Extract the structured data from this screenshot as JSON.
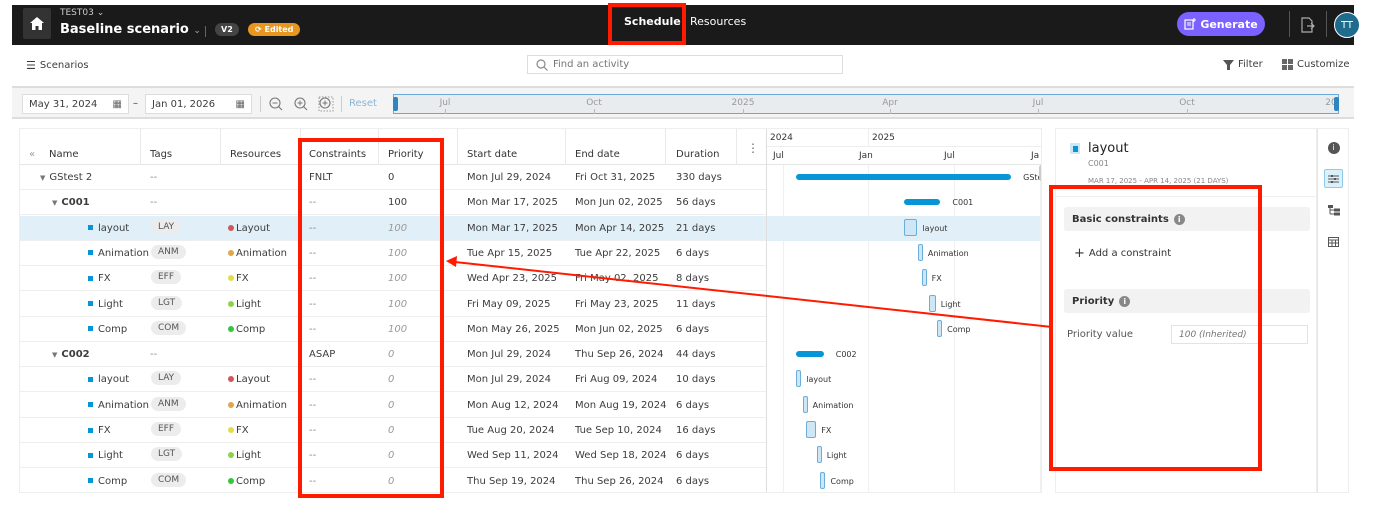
{
  "header": {
    "project": "TEST03",
    "scenario": "Baseline scenario",
    "version": "V2",
    "edited": "Edited",
    "tabs": [
      {
        "label": "Schedule",
        "active": true
      },
      {
        "label": "Resources",
        "active": false
      }
    ],
    "generate": "Generate",
    "avatar": "TT",
    "accent_color": "#7b61ff",
    "edited_color": "#e8961f"
  },
  "toolbar": {
    "scenarios": "Scenarios",
    "search_placeholder": "Find an activity",
    "filter": "Filter",
    "customize": "Customize"
  },
  "range": {
    "start": "May 31, 2024",
    "end": "Jan 01, 2026",
    "reset": "Reset",
    "ticks": [
      "Jul",
      "Oct",
      "2025",
      "Apr",
      "Jul",
      "Oct",
      "20"
    ]
  },
  "grid": {
    "columns": [
      "Name",
      "Tags",
      "Resources",
      "Constraints",
      "Priority",
      "Start date",
      "End date",
      "Duration"
    ],
    "rows": [
      {
        "name": "GStest 2",
        "level": 0,
        "group": true,
        "tag": "--",
        "resource": "",
        "res_color": "",
        "constraint": "FNLT",
        "priority": "0",
        "pri_italic": false,
        "start": "Mon Jul 29, 2024",
        "end": "Fri Oct 31, 2025",
        "duration": "330 days"
      },
      {
        "name": "C001",
        "level": 1,
        "group": true,
        "tag": "--",
        "resource": "",
        "res_color": "",
        "constraint": "--",
        "priority": "100",
        "pri_italic": false,
        "start": "Mon Mar 17, 2025",
        "end": "Mon Jun 02, 2025",
        "duration": "56 days"
      },
      {
        "name": "layout",
        "level": 2,
        "group": false,
        "selected": true,
        "tag": "LAY",
        "resource": "Layout",
        "res_color": "#d0575a",
        "constraint": "--",
        "priority": "100",
        "pri_italic": true,
        "start": "Mon Mar 17, 2025",
        "end": "Mon Apr 14, 2025",
        "duration": "21 days"
      },
      {
        "name": "Animation",
        "level": 2,
        "group": false,
        "tag": "ANM",
        "resource": "Animation",
        "res_color": "#e0a64a",
        "constraint": "--",
        "priority": "100",
        "pri_italic": true,
        "start": "Tue Apr 15, 2025",
        "end": "Tue Apr 22, 2025",
        "duration": "6 days"
      },
      {
        "name": "FX",
        "level": 2,
        "group": false,
        "tag": "EFF",
        "resource": "FX",
        "res_color": "#e2dc4a",
        "constraint": "--",
        "priority": "100",
        "pri_italic": true,
        "start": "Wed Apr 23, 2025",
        "end": "Fri May 02, 2025",
        "duration": "8 days"
      },
      {
        "name": "Light",
        "level": 2,
        "group": false,
        "tag": "LGT",
        "resource": "Light",
        "res_color": "#8ed24a",
        "constraint": "--",
        "priority": "100",
        "pri_italic": true,
        "start": "Fri May 09, 2025",
        "end": "Fri May 23, 2025",
        "duration": "11 days"
      },
      {
        "name": "Comp",
        "level": 2,
        "group": false,
        "tag": "COM",
        "resource": "Comp",
        "res_color": "#2fc83a",
        "constraint": "--",
        "priority": "100",
        "pri_italic": true,
        "start": "Mon May 26, 2025",
        "end": "Mon Jun 02, 2025",
        "duration": "6 days"
      },
      {
        "name": "C002",
        "level": 1,
        "group": true,
        "tag": "--",
        "resource": "",
        "res_color": "",
        "constraint": "ASAP",
        "priority": "0",
        "pri_italic": true,
        "start": "Mon Jul 29, 2024",
        "end": "Thu Sep 26, 2024",
        "duration": "44 days"
      },
      {
        "name": "layout",
        "level": 2,
        "group": false,
        "tag": "LAY",
        "resource": "Layout",
        "res_color": "#d0575a",
        "constraint": "--",
        "priority": "0",
        "pri_italic": true,
        "start": "Mon Jul 29, 2024",
        "end": "Fri Aug 09, 2024",
        "duration": "10 days"
      },
      {
        "name": "Animation",
        "level": 2,
        "group": false,
        "tag": "ANM",
        "resource": "Animation",
        "res_color": "#e0a64a",
        "constraint": "--",
        "priority": "0",
        "pri_italic": true,
        "start": "Mon Aug 12, 2024",
        "end": "Mon Aug 19, 2024",
        "duration": "6 days"
      },
      {
        "name": "FX",
        "level": 2,
        "group": false,
        "tag": "EFF",
        "resource": "FX",
        "res_color": "#e2dc4a",
        "constraint": "--",
        "priority": "0",
        "pri_italic": true,
        "start": "Tue Aug 20, 2024",
        "end": "Tue Sep 10, 2024",
        "duration": "16 days"
      },
      {
        "name": "Light",
        "level": 2,
        "group": false,
        "tag": "LGT",
        "resource": "Light",
        "res_color": "#8ed24a",
        "constraint": "--",
        "priority": "0",
        "pri_italic": true,
        "start": "Wed Sep 11, 2024",
        "end": "Wed Sep 18, 2024",
        "duration": "6 days"
      },
      {
        "name": "Comp",
        "level": 2,
        "group": false,
        "tag": "COM",
        "resource": "Comp",
        "res_color": "#2fc83a",
        "constraint": "--",
        "priority": "0",
        "pri_italic": true,
        "start": "Thu Sep 19, 2024",
        "end": "Thu Sep 26, 2024",
        "duration": "6 days"
      }
    ]
  },
  "gantt": {
    "years": [
      "2024",
      "2025"
    ],
    "months": [
      "Jul",
      "Jan",
      "Jul",
      "Ja"
    ],
    "labels": [
      "GSte",
      "C001",
      "layout",
      "Animation",
      "FX",
      "Light",
      "Comp",
      "C002",
      "layout",
      "Animation",
      "FX",
      "Light",
      "Comp"
    ]
  },
  "props": {
    "title": "layout",
    "parent": "C001",
    "range": "MAR 17, 2025 - APR 14, 2025 (21 DAYS)",
    "basic_constraints": "Basic constraints",
    "add_constraint": "Add a constraint",
    "priority_section": "Priority",
    "priority_label": "Priority value",
    "priority_placeholder": "100 (Inherited)"
  }
}
